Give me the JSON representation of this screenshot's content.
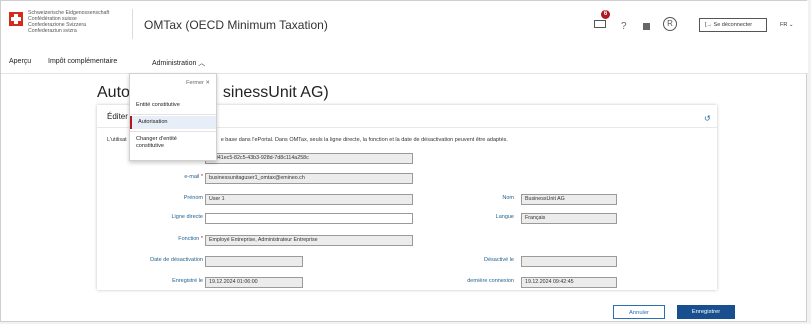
{
  "header": {
    "confed_lines": [
      "Schweizerische Eidgenossenschaft",
      "Confédération suisse",
      "Confederazione Svizzera",
      "Confederaziun svizra"
    ],
    "app_title": "OMTax (OECD Minimum Taxation)",
    "mail_badge": "6",
    "help": "?",
    "user_initial": "R",
    "logout_label": "[→ Se déconnecter",
    "lang": "FR ⌄"
  },
  "nav": {
    "apercu": "Aperçu",
    "impot": "Impôt complémentaire",
    "admin": "Administration ︿"
  },
  "dropdown": {
    "close": "Fermer ✕",
    "items": [
      "Entité constitutive",
      "Autorisation",
      "Changer d'entité\nconstitutive"
    ]
  },
  "page": {
    "title": "Autorisation (BusinessUnit AG)",
    "title_visible": "Auto",
    "title_right": "sinessUnit AG)"
  },
  "card": {
    "edit": "Éditer",
    "intro_left": "L'utilisat",
    "intro": "e base dans l'ePortal. Dans OMTax, seuls la ligne directe, la fonction et la date de désactivation peuvent être adaptés.",
    "undo_icon": "↺"
  },
  "form": {
    "id_value": "e2041ec5-82c5-43b3-928d-7d8c114a258c",
    "email_label": "e-mail",
    "email_value": "businessunitaguser1_omtax@emineo.ch",
    "prenom_label": "Prénom",
    "prenom_value": "User 1",
    "nom_label": "Nom",
    "nom_value": "BusinessUnit AG",
    "ligne_label": "Ligne directe",
    "ligne_value": "",
    "langue_label": "Langue",
    "langue_value": "Français",
    "fonction_label": "Fonction",
    "fonction_value": "Employé Entreprise, Administrateur Entreprise",
    "date_desact_label": "Date de désactivation",
    "date_desact_value": "",
    "desactive_label": "Désactivé le",
    "desactive_value": "",
    "enregistre_label": "Enregistré le",
    "enregistre_value": "19.12.2024 01:06:00",
    "derniere_label": "dernière connexion",
    "derniere_value": "19.12.2024 09:42:45",
    "req_mark": "*"
  },
  "buttons": {
    "cancel": "Annuler",
    "save": "Enregistrer"
  },
  "colors": {
    "accent": "#1a4f8f",
    "swiss_red": "#d52b1e",
    "badge": "#b0171f"
  }
}
